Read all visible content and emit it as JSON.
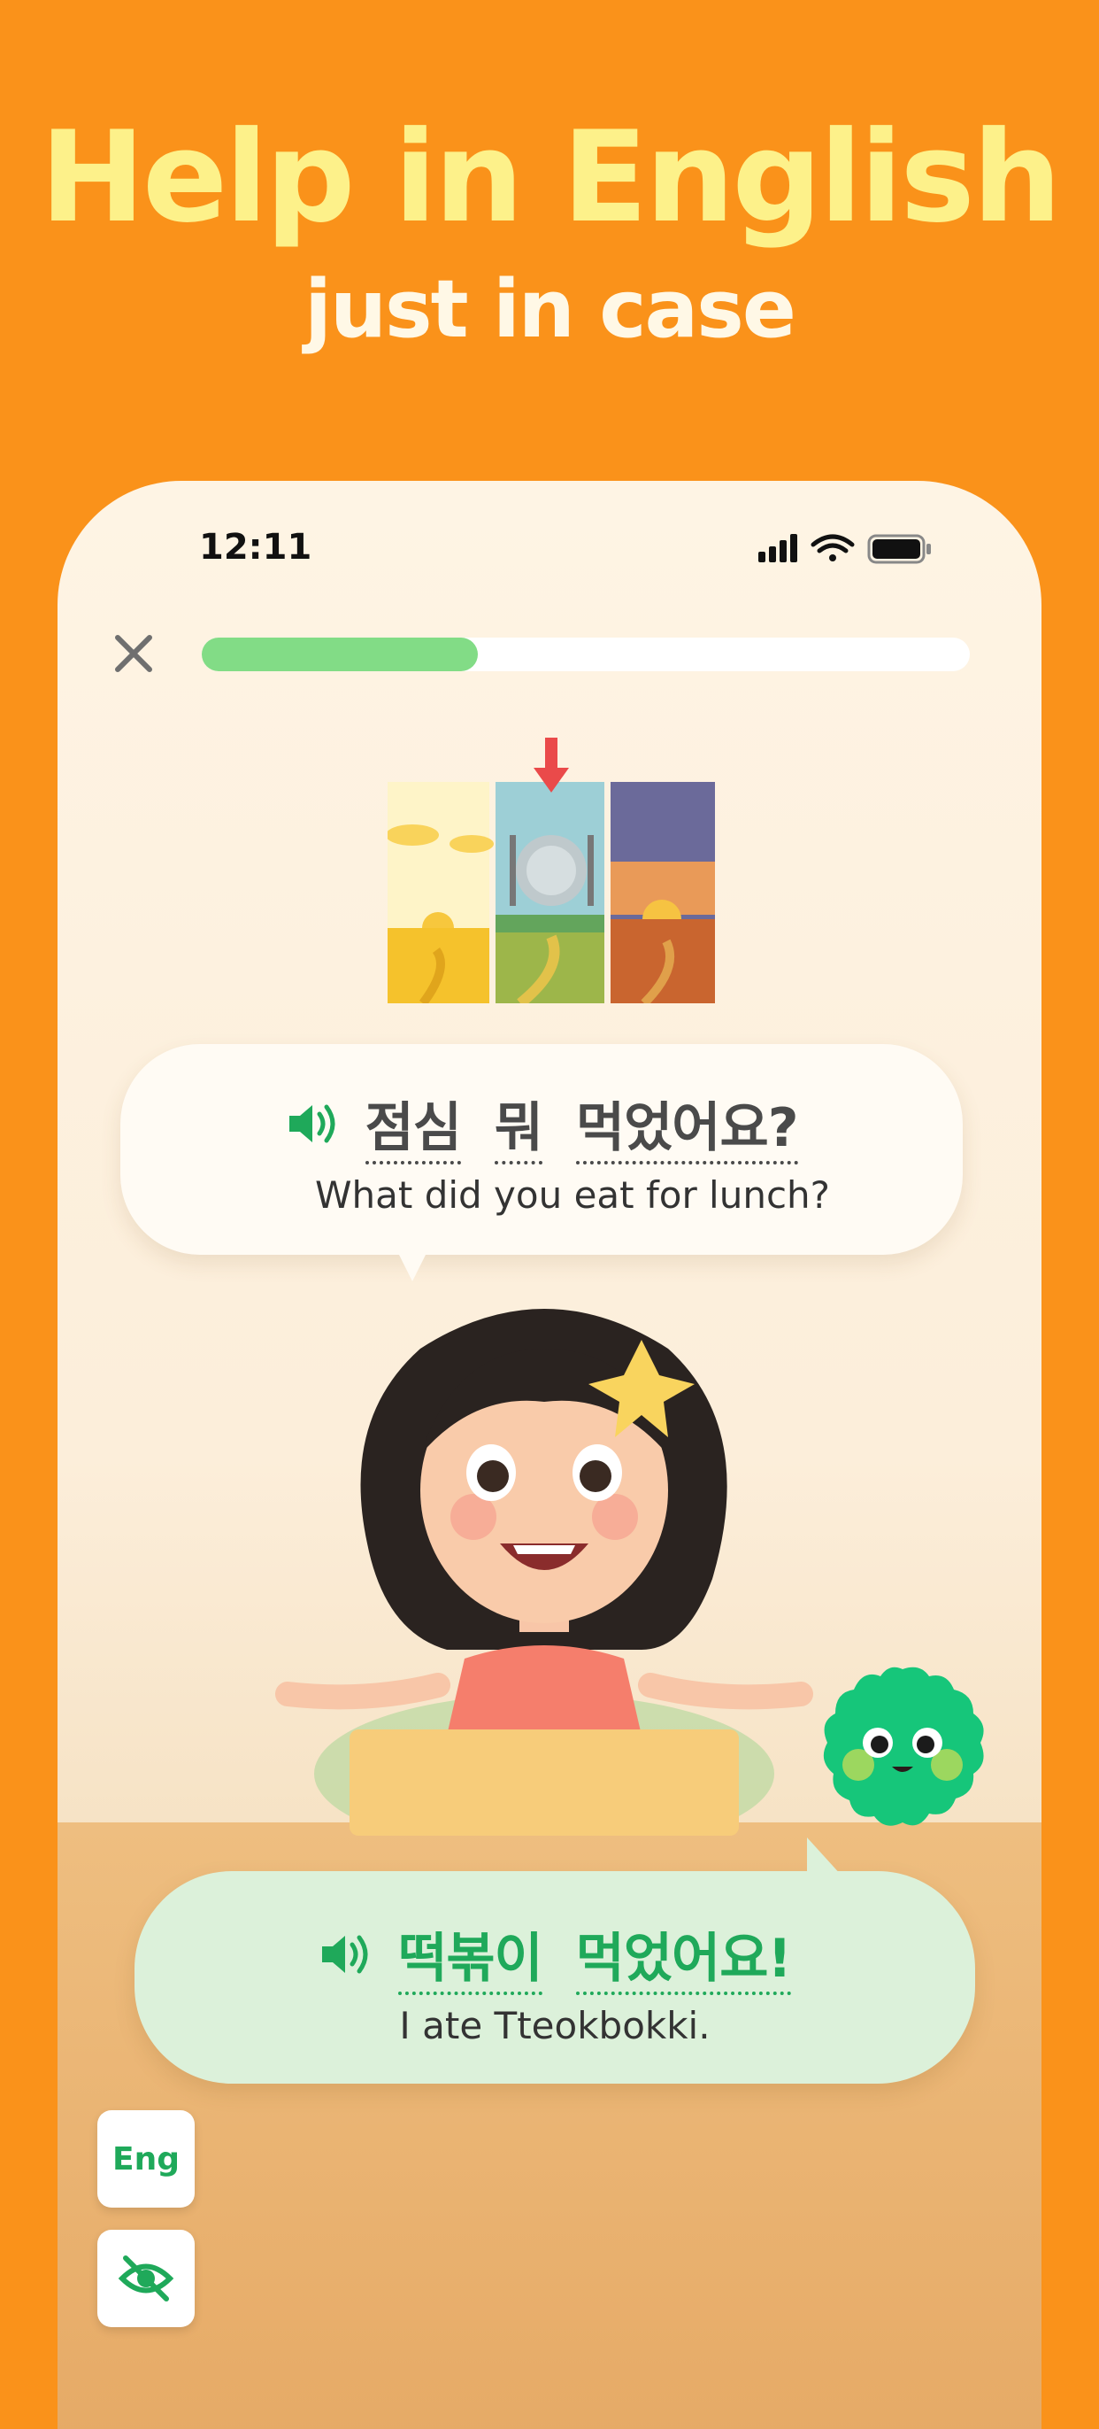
{
  "promo": {
    "headline": "Help in English",
    "subheadline": "just in case"
  },
  "status_bar": {
    "time": "12:11",
    "icons": [
      "cellular-signal-icon",
      "wifi-icon",
      "battery-icon"
    ]
  },
  "lesson": {
    "close_icon": "close-icon",
    "progress": 0.36
  },
  "scene_image": {
    "description_icon": "time-of-day-panels-icon"
  },
  "question": {
    "speaker_icon": "speaker-icon",
    "korean_words": [
      "점심",
      "뭐",
      "먹었어요?"
    ],
    "english": "What did you eat for lunch?"
  },
  "answer": {
    "speaker_icon": "speaker-icon",
    "korean_words": [
      "떡볶이",
      "먹었어요!"
    ],
    "english": "I ate Tteokbokki."
  },
  "controls": {
    "english_toggle_label": "Eng",
    "hide_hint_icon": "eye-off-icon"
  },
  "colors": {
    "background": "#FA921A",
    "headline": "#FDF18A",
    "accent_green": "#1FA95A",
    "progress_fill": "#82DC86"
  }
}
